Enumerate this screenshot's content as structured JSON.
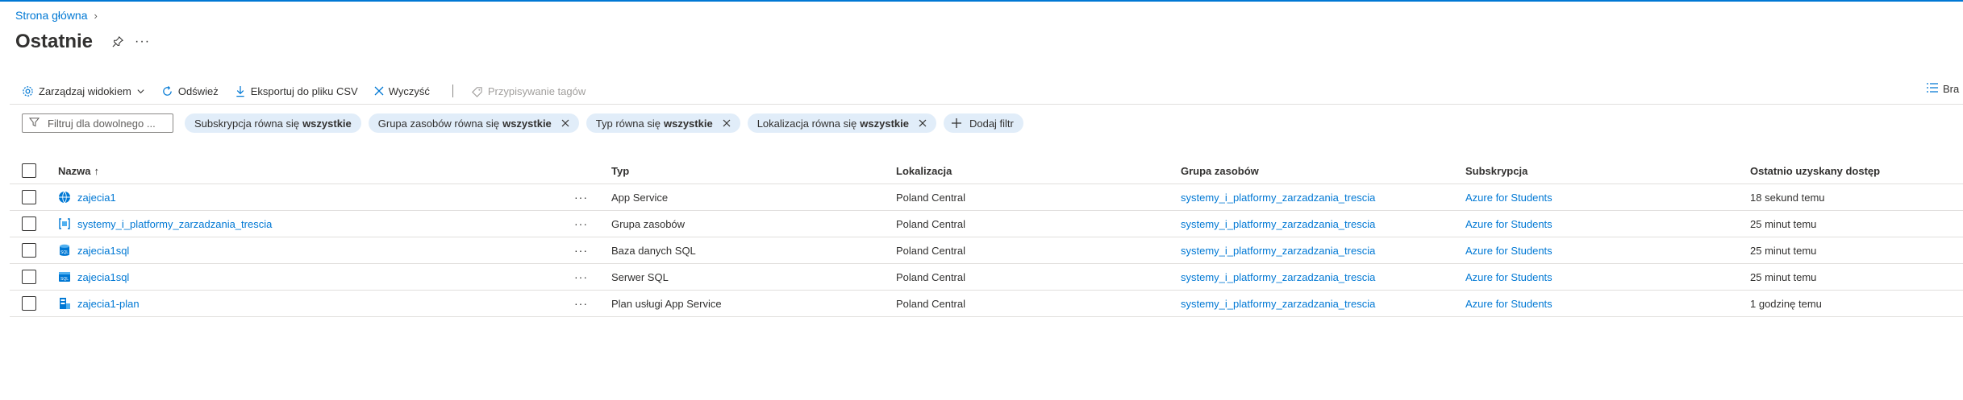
{
  "breadcrumb": {
    "home": "Strona główna",
    "separator": "›"
  },
  "page": {
    "title": "Ostatnie",
    "more": "···"
  },
  "toolbar": {
    "manage_view": "Zarządzaj widokiem",
    "refresh": "Odśwież",
    "export_csv": "Eksportuj do pliku CSV",
    "clear": "Wyczyść",
    "assign_tags": "Przypisywanie tagów",
    "right_label": "Bra"
  },
  "filters": {
    "search_placeholder": "Filtruj dla dowolnego ...",
    "pills": [
      {
        "prefix": "Subskrypcja równa się",
        "value": "wszystkie"
      },
      {
        "prefix": "Grupa zasobów równa się",
        "value": "wszystkie"
      },
      {
        "prefix": "Typ równa się",
        "value": "wszystkie"
      },
      {
        "prefix": "Lokalizacja równa się",
        "value": "wszystkie"
      }
    ],
    "add_filter": "Dodaj filtr"
  },
  "table": {
    "columns": {
      "name": "Nazwa",
      "name_sort": "↑",
      "type": "Typ",
      "location": "Lokalizacja",
      "resource_group": "Grupa zasobów",
      "subscription": "Subskrypcja",
      "last_accessed": "Ostatnio uzyskany dostęp"
    },
    "rows": [
      {
        "name": "zajecia1",
        "icon": "app-service-icon",
        "type": "App Service",
        "location": "Poland Central",
        "resource_group": "systemy_i_platformy_zarzadzania_trescia",
        "subscription": "Azure for Students",
        "last_accessed": "18 sekund temu"
      },
      {
        "name": "systemy_i_platformy_zarzadzania_trescia",
        "icon": "resource-group-icon",
        "type": "Grupa zasobów",
        "location": "Poland Central",
        "resource_group": "systemy_i_platformy_zarzadzania_trescia",
        "subscription": "Azure for Students",
        "last_accessed": "25 minut temu"
      },
      {
        "name": "zajecia1sql",
        "icon": "sql-database-icon",
        "type": "Baza danych SQL",
        "location": "Poland Central",
        "resource_group": "systemy_i_platformy_zarzadzania_trescia",
        "subscription": "Azure for Students",
        "last_accessed": "25 minut temu"
      },
      {
        "name": "zajecia1sql",
        "icon": "sql-server-icon",
        "type": "Serwer SQL",
        "location": "Poland Central",
        "resource_group": "systemy_i_platformy_zarzadzania_trescia",
        "subscription": "Azure for Students",
        "last_accessed": "25 minut temu"
      },
      {
        "name": "zajecia1-plan",
        "icon": "app-service-plan-icon",
        "type": "Plan usługi App Service",
        "location": "Poland Central",
        "resource_group": "systemy_i_platformy_zarzadzania_trescia",
        "subscription": "Azure for Students",
        "last_accessed": "1 godzinę temu"
      }
    ],
    "row_more": "···"
  },
  "colors": {
    "accent": "#0078d4",
    "pill_bg": "#e1edf9",
    "divider": "#e1dfdd"
  }
}
